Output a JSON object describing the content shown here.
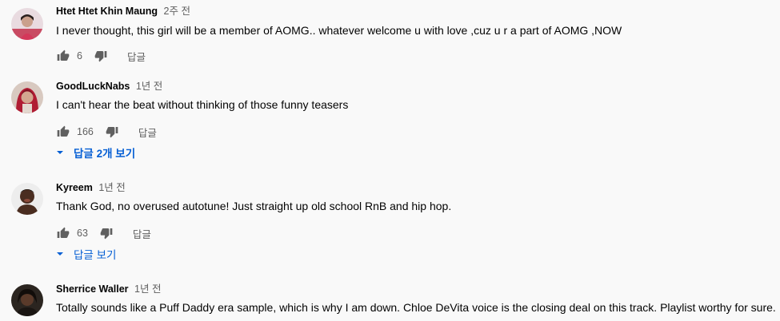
{
  "icons": {
    "like": "thumb-up-icon",
    "dislike": "thumb-down-icon",
    "expand": "caret-down-icon"
  },
  "colors": {
    "author": "#030303",
    "meta": "#606060",
    "link": "#065fd4",
    "background": "#f9f9f9"
  },
  "comments": [
    {
      "author": "Htet Htet Khin Maung",
      "time": "2주 전",
      "text": "I never thought, this girl will be a member of AOMG.. whatever welcome u with love ,cuz u r a part of AOMG ,NOW",
      "likes": "6",
      "reply_label": "답글",
      "view_replies": ""
    },
    {
      "author": "GoodLuckNabs",
      "time": "1년 전",
      "text": "I can't hear the beat without thinking of those funny teasers",
      "likes": "166",
      "reply_label": "답글",
      "view_replies": "답글 2개 보기"
    },
    {
      "author": "Kyreem",
      "time": "1년 전",
      "text": "Thank God, no overused autotune! Just straight up old school RnB and hip hop.",
      "likes": "63",
      "reply_label": "답글",
      "view_replies": "답글 보기"
    },
    {
      "author": "Sherrice Waller",
      "time": "1년 전",
      "text": "Totally sounds like a Puff Daddy era sample, which is why I am down. Chloe DeVita voice is the closing deal on this track. Playlist worthy for sure.",
      "likes": "",
      "reply_label": "",
      "view_replies": ""
    }
  ]
}
